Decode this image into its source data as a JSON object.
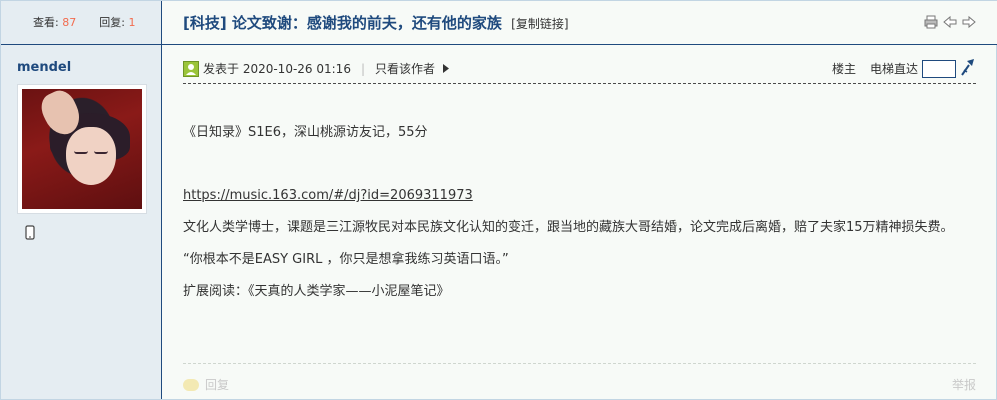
{
  "thread": {
    "views_label": "查看:",
    "views": "87",
    "replies_label": "回复:",
    "replies": "1",
    "title": "[科技] 论文致谢：感谢我的前夫，还有他的家族",
    "copy_link": "[复制链接]"
  },
  "header_icons": [
    "print-icon",
    "prev-thread-icon",
    "next-thread-icon"
  ],
  "author": {
    "name": "mendel",
    "device_icon": "mobile-phone-icon"
  },
  "post_meta": {
    "posted_at": "发表于 2020-10-26 01:16",
    "separator": "|",
    "only_author": "只看该作者",
    "floor": "楼主",
    "jump_label": "电梯直达",
    "jump_value": ""
  },
  "content": {
    "line1": "《日知录》S1E6，深山桃源访友记，55分",
    "link": "https://music.163.com/#/dj?id=2069311973",
    "para1": "文化人类学博士，课题是三江源牧民对本民族文化认知的变迁，跟当地的藏族大哥结婚，论文完成后离婚，赔了夫家15万精神损失费。",
    "quote": "“你根本不是EASY GIRL ，你只是想拿我练习英语口语。”",
    "further": "扩展阅读：《天真的人类学家——小泥屋笔记》"
  },
  "footer": {
    "reply": "回复",
    "report": "举报"
  },
  "colors": {
    "accent": "#1f4a7e",
    "count": "#f26c4f",
    "sidebar_bg": "#e5edf2",
    "post_bg": "#f7faf7"
  }
}
